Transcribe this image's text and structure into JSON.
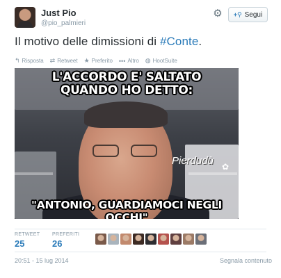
{
  "user": {
    "name": "Just Pio",
    "handle": "@pio_palmieri"
  },
  "header": {
    "follow_label": "Segui",
    "follow_icon": "user-plus-icon",
    "settings_icon": "gear-icon"
  },
  "tweet": {
    "text_before": "Il motivo delle dimissioni di ",
    "hashtag": "#Conte",
    "text_after": "."
  },
  "actions": [
    {
      "icon": "reply-icon",
      "label": "Risposta"
    },
    {
      "icon": "retweet-icon",
      "label": "Retweet"
    },
    {
      "icon": "star-icon",
      "label": "Preferito"
    },
    {
      "icon": "more-icon",
      "label": "Altro"
    },
    {
      "icon": "hootsuite-icon",
      "label": "HootSuite"
    }
  ],
  "media": {
    "caption_top_line1": "L'ACCORDO E' SALTATO",
    "caption_top_line2": "QUANDO HO DETTO:",
    "caption_bottom": "\"ANTONIO, GUARDIAMOCI NEGLI OCCHI\"",
    "watermark": "Pierdudù"
  },
  "stats": {
    "retweet_label": "RETWEET",
    "retweet_count": "25",
    "favorites_label": "PREFERITI",
    "favorites_count": "26"
  },
  "favoriters": [
    {
      "color": "#7a5a4a"
    },
    {
      "color": "#a9b4bd"
    },
    {
      "color": "#c28a6e"
    },
    {
      "color": "#3d2b24"
    },
    {
      "color": "#2d2d31"
    },
    {
      "color": "#b5524d"
    },
    {
      "color": "#604040"
    },
    {
      "color": "#9b7a66"
    },
    {
      "color": "#6b6f78"
    }
  ],
  "footer": {
    "timestamp": "20:51 - 15 lug 2014",
    "report_label": "Segnala contenuto"
  },
  "colors": {
    "link": "#2b7bb9",
    "muted": "#8899a6",
    "text": "#292f33"
  }
}
